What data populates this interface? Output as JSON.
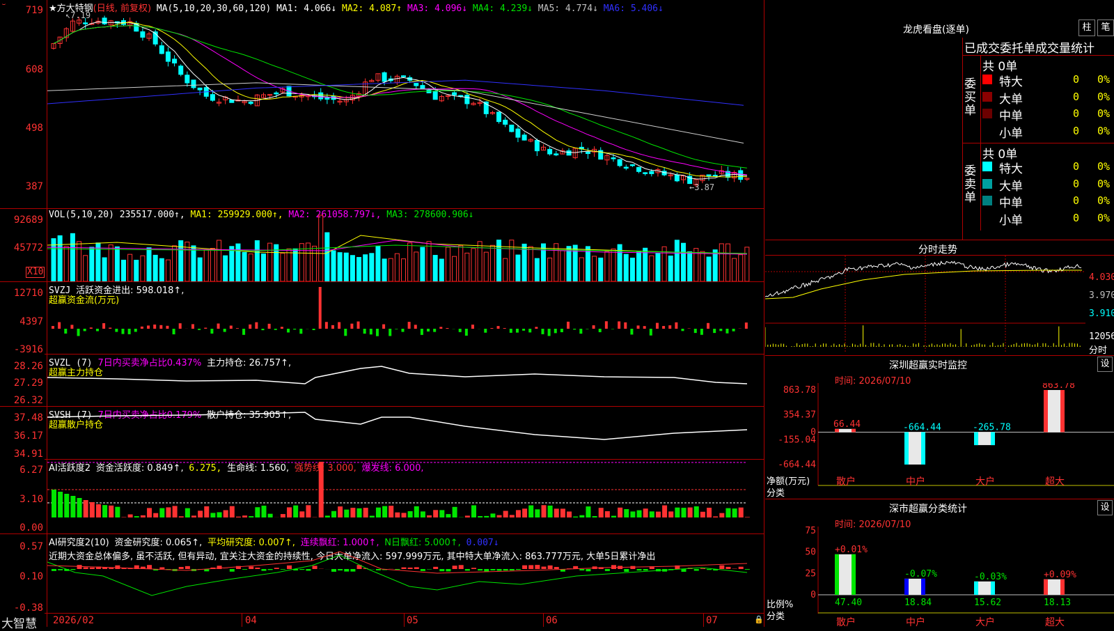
{
  "app_logo": "大智慧",
  "main_chart": {
    "title": "★方大特钢",
    "period": "(日线, 前复权)",
    "ma_label": "MA(5,10,20,30,60,120)",
    "ma_values": [
      {
        "label": "MA1: 4.066↓",
        "color": "#ffffff"
      },
      {
        "label": "MA2: 4.087↑",
        "color": "#ffff00"
      },
      {
        "label": "MA3: 4.096↓",
        "color": "#ff00ff"
      },
      {
        "label": "MA4: 4.239↓",
        "color": "#00e600"
      },
      {
        "label": "MA5: 4.774↓",
        "color": "#c0c0c0"
      },
      {
        "label": "MA6: 5.406↓",
        "color": "#3030ff"
      }
    ],
    "y_ticks": [
      "719",
      "608",
      "498",
      "387"
    ],
    "high_marker": "7.19",
    "low_marker": "←3.87"
  },
  "vol_panel": {
    "label": "VOL(5,10,20)",
    "value": "235517.000↑,",
    "ma1": "MA1: 259929.000↑,",
    "ma2": "MA2: 261058.797↓,",
    "ma3": "MA3: 278600.906↓",
    "y_ticks": [
      "92689",
      "45772"
    ],
    "unit": "X10"
  },
  "svzj_panel": {
    "label": "SVZJ",
    "text": "活跃资金进出: 598.018↑,",
    "subtitle": "超赢资金流(万元)",
    "y_ticks": [
      "12710",
      "4397",
      "-3916"
    ]
  },
  "svzl_panel": {
    "label": "SVZL (7)",
    "text1": "7日内买卖净占比0.437%",
    "text2": "主力持仓: 26.757↑,",
    "subtitle": "超赢主力持仓",
    "y_ticks": [
      "28.26",
      "27.29",
      "26.32"
    ]
  },
  "svsh_panel": {
    "label": "SVSH (7)",
    "text1": "7日内买卖净占比0.179%",
    "text2": "散户持仓: 35.905↑,",
    "subtitle": "超赢散户持仓",
    "y_ticks": [
      "37.48",
      "36.17",
      "34.91"
    ]
  },
  "ai_active_panel": {
    "label": "AI活跃度2",
    "text1": "资金活跃度: 0.849↑,",
    "text2": "6.275,",
    "text3": "生命线: 1.560,",
    "text4": "强势线: 3.000,",
    "text5": "爆发线: 6.000,",
    "y_ticks": [
      "6.27",
      "3.10",
      "0.00"
    ]
  },
  "ai_research_panel": {
    "label": "AI研究度2(10)",
    "text1": "资金研究度: 0.065↑,",
    "text2": "平均研究度: 0.007↑,",
    "text3": "连续飘红: 1.000↑,",
    "text4": "N日飘红: 5.000↑,",
    "text5": "0.007↓",
    "comment": "近期大资金总体偏多, 虽不活跃, 但有异动, 宜关注大资金的持续性, 今日大单净流入: 597.999万元, 其中特大单净流入: 863.777万元, 大单5日累计净出",
    "y_ticks": [
      "0.57",
      "0.10",
      "-0.38"
    ]
  },
  "x_axis": [
    "2026/02",
    "04",
    "05",
    "06",
    "07"
  ],
  "right_panel": {
    "dragon_title": "龙虎看盘(逐单)",
    "btn_bar": "柱",
    "btn_pen": "笔",
    "stats_title": "已成交委托单成交量统计",
    "buy_side_label": "委买单",
    "sell_side_label": "委卖单",
    "buy_total": "共 0单",
    "sell_total": "共 0单",
    "buy_rows": [
      {
        "name": "特大",
        "count": "0",
        "pct": "0%",
        "color": "#ff0000"
      },
      {
        "name": "大单",
        "count": "0",
        "pct": "0%",
        "color": "#8b0000"
      },
      {
        "name": "中单",
        "count": "0",
        "pct": "0%",
        "color": "#6b0000"
      },
      {
        "name": "小单",
        "count": "0",
        "pct": "0%",
        "color": ""
      }
    ],
    "sell_rows": [
      {
        "name": "特大",
        "count": "0",
        "pct": "0%",
        "color": "#00ffff"
      },
      {
        "name": "大单",
        "count": "0",
        "pct": "0%",
        "color": "#00a0a0"
      },
      {
        "name": "中单",
        "count": "0",
        "pct": "0%",
        "color": "#008080"
      },
      {
        "name": "小单",
        "count": "0",
        "pct": "0%",
        "color": ""
      }
    ],
    "intraday_title": "分时走势",
    "intraday_prices": [
      "4.030",
      "3.970",
      "3.910"
    ],
    "intraday_vol": "12056",
    "intraday_vol_label": "分时",
    "sz_monitor_title": "深圳超赢实时监控",
    "sz_monitor_btn": "设",
    "sz_time": "时间: 2026/07/10",
    "sz_y_ticks": [
      "863.78",
      "354.37",
      "0",
      "-155.04",
      "-664.44"
    ],
    "sz_ylabel_1": "净额(万元)",
    "sz_ylabel_2": "分类",
    "sz_bars": [
      {
        "cat": "散户",
        "value": "66.44",
        "color": "#ff3232"
      },
      {
        "cat": "中户",
        "value": "-664.44",
        "color": "#00ffff"
      },
      {
        "cat": "大户",
        "value": "-265.78",
        "color": "#00ffff"
      },
      {
        "cat": "超大",
        "value": "863.78",
        "color": "#ff3232"
      }
    ],
    "cls_title": "深市超赢分类统计",
    "cls_btn": "设",
    "cls_time": "时间: 2026/07/10",
    "cls_y_ticks": [
      "75",
      "50",
      "25",
      "0"
    ],
    "cls_ylabel_1": "比例%",
    "cls_ylabel_2": "分类",
    "cls_bars": [
      {
        "cat": "散户",
        "value": "47.40",
        "delta": "+0.01%",
        "delta_color": "#ff3232"
      },
      {
        "cat": "中户",
        "value": "18.84",
        "delta": "-0.07%",
        "delta_color": "#00e600"
      },
      {
        "cat": "大户",
        "value": "15.62",
        "delta": "-0.03%",
        "delta_color": "#00e600"
      },
      {
        "cat": "超大",
        "value": "18.13",
        "delta": "+0.09%",
        "delta_color": "#ff3232"
      }
    ]
  },
  "chart_data": [
    {
      "type": "bar",
      "title": "深圳超赢实时监控",
      "xlabel": "分类",
      "ylabel": "净额(万元)",
      "categories": [
        "散户",
        "中户",
        "大户",
        "超大"
      ],
      "values": [
        66.44,
        -664.44,
        -265.78,
        863.78
      ],
      "ylim": [
        -664.44,
        863.78
      ]
    },
    {
      "type": "bar",
      "title": "深市超赢分类统计",
      "xlabel": "分类",
      "ylabel": "比例%",
      "categories": [
        "散户",
        "中户",
        "大户",
        "超大"
      ],
      "values": [
        47.4,
        18.84,
        15.62,
        18.13
      ],
      "ylim": [
        0,
        75
      ]
    }
  ]
}
